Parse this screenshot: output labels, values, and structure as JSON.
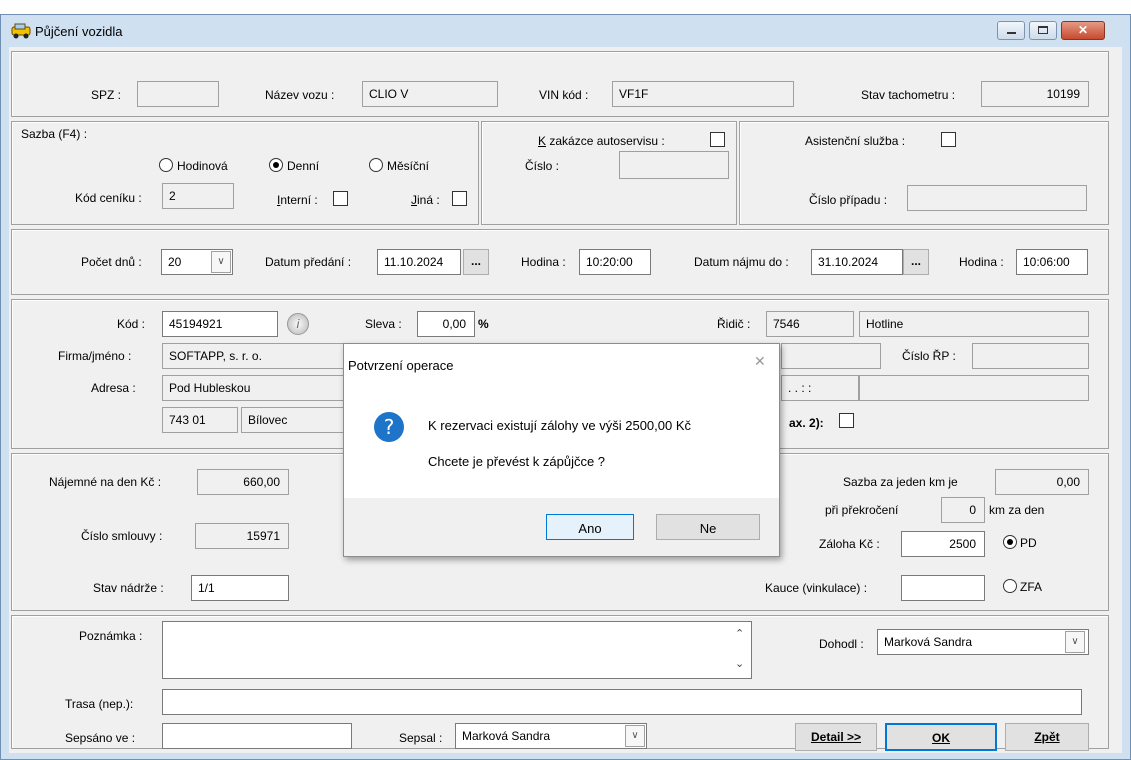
{
  "window": {
    "title": "Půjčení vozidla"
  },
  "vehicle": {
    "spz_label": "SPZ :",
    "spz_value": "",
    "name_label": "Název vozu :",
    "name_value": "CLIO V",
    "vin_label": "VIN kód :",
    "vin_value": "VF1F",
    "odometer_label": "Stav tachometru :",
    "odometer_value": "10199"
  },
  "rate": {
    "label": "Sazba (F4) :",
    "options": [
      "Hodinová",
      "Denní",
      "Měsíční"
    ],
    "selected": "Denní",
    "price_list_label": "Kód ceníku :",
    "price_list_value": "2",
    "internal_label": "Interní :",
    "other_label": "Jiná :"
  },
  "order": {
    "autoservice_label": "zakázce autoservisu :",
    "autoservice_prefix": "K",
    "number_label": "Číslo :",
    "number_value": ""
  },
  "assist": {
    "label": "Asistenční služba :",
    "case_label": "Číslo případu :",
    "case_value": ""
  },
  "period": {
    "days_label": "Počet dnů :",
    "days_value": "20",
    "handover_label": "Datum předání :",
    "handover_value": "11.10.2024",
    "hour1_label": "Hodina :",
    "hour1_value": "10:20:00",
    "until_label": "Datum nájmu do :",
    "until_value": "31.10.2024",
    "hour2_label": "Hodina :",
    "hour2_value": "10:06:00",
    "ellipsis": "..."
  },
  "customer": {
    "code_label": "Kód :",
    "code_value": "45194921",
    "discount_label": "Sleva :",
    "discount_value": "0,00",
    "discount_unit": "%",
    "driver_label": "Řidič :",
    "driver_code": "7546",
    "driver_name": "Hotline",
    "company_label": "Firma/jméno :",
    "company_value": "SOFTAPP, s. r. o.",
    "rp_label": "Číslo ŘP :",
    "rp_value": "",
    "address_label": "Adresa :",
    "street": "Pod Hubleskou",
    "zip": "743 01",
    "city": "Bílovec",
    "date_mask": ". .       : :",
    "max_label": "ax. 2):"
  },
  "rental": {
    "daily_label": "Nájemné na den Kč :",
    "daily_value": "660,00",
    "contract_label": "Číslo smlouvy :",
    "contract_value": "15971",
    "tank_label": "Stav nádrže :",
    "tank_value": "1/1",
    "km_rate_label": "Sazba za jeden km je",
    "km_rate_value": "0,00",
    "exceed_label": "při překročení",
    "exceed_value": "0",
    "km_per_day": "km za den",
    "deposit_label": "Záloha Kč :",
    "deposit_value": "2500",
    "bail_label": "Kauce (vinkulace) :",
    "bail_value": "",
    "pay_options": [
      "PD",
      "ZFA"
    ],
    "pay_selected": "PD"
  },
  "notes": {
    "note_label": "Poznámka :",
    "note_value": "",
    "agreed_label": "Dohodl :",
    "agreed_value": "Marková Sandra",
    "route_label": "Trasa (nep.):",
    "route_value": "",
    "written_in_label": "Sepsáno ve :",
    "written_in_value": "",
    "written_by_label": "Sepsal :",
    "written_by_value": "Marková Sandra"
  },
  "buttons": {
    "detail": "Detail >>",
    "ok": "OK",
    "back": "Zpět"
  },
  "dialog": {
    "title": "Potvrzení operace",
    "line1": "K rezervaci existují zálohy ve výši 2500,00 Kč",
    "line2": "Chcete je převést k zápůjčce ?",
    "yes": "Ano",
    "no": "Ne",
    "close": "✕",
    "icon": "?"
  },
  "colors": {
    "accent": "#0078d7",
    "title_bg": "#cfe0f1",
    "close_btn": "#c74a2d"
  }
}
